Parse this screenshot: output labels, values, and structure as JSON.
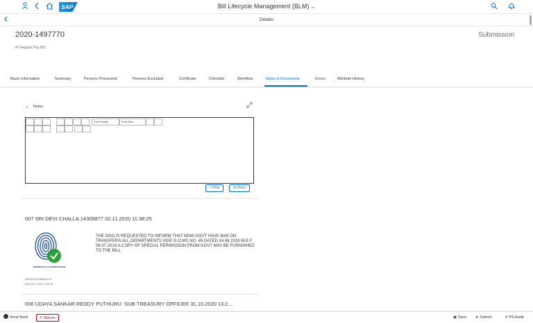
{
  "shell": {
    "title": "Bill Lifecycle Management (BLM)",
    "logo": "SAP",
    "icons": [
      "user-icon",
      "back-icon",
      "home-icon",
      "search-icon",
      "notification-icon"
    ]
  },
  "subheader": {
    "title": "Details"
  },
  "object": {
    "title": "2020-1497770",
    "subtitle": "47-Regular Pay Bill",
    "status": "Submission"
  },
  "tabs": [
    {
      "label": "Basic Information"
    },
    {
      "label": "Summary"
    },
    {
      "label": "Persons Processed"
    },
    {
      "label": "Persons Excluded"
    },
    {
      "label": "Certificate"
    },
    {
      "label": "Checklist"
    },
    {
      "label": "Workflow"
    },
    {
      "label": "Notes & Documents"
    },
    {
      "label": "Errors"
    },
    {
      "label": "Attribute History"
    }
  ],
  "active_tab": "Notes & Documents",
  "notes": {
    "title": "Notes",
    "font_family_label": "Font Family",
    "font_size_label": "Font Size",
    "post_label": "Post",
    "clear_label": "Clear"
  },
  "comments": [
    {
      "header": "007 SRI DEVI CHALLA 14309877 02.11.2020 11:38:25",
      "stamp_label": "BIOMETRICS AUTHENTICATION",
      "text": "THE DDO IS REQUESTED TO INFORM THAT NOW GOVT HAVE BAN ON TRANSFERS ALL DEPARTMENTS VIDE G.O.MS NO. 45 DATED 24.06.2019 W.E.F 06.07.2019.A COPY OF SPECIAL PERMISSION FROM GOVT MAY BE FURNISHED TO THE BILL",
      "meta1": "BAKVPA0474BBMACYE",
      "meta2": "Date:02.11.2020 11:38:25"
    },
    {
      "header": "006 UDAYA SANKAR REDDY PUTHURU -SUB TREASURY OFFICER 31.10.2020 13:2..."
    }
  ],
  "footer": {
    "send_back": "Send Back",
    "return": "Return",
    "save": "Save",
    "submit": "Submit",
    "ps_audit": "PS-Audit"
  },
  "colors": {
    "accent": "#0a6ed1",
    "text": "#32363a",
    "reject": "#bb0000",
    "check_green": "#2b9e3a"
  }
}
